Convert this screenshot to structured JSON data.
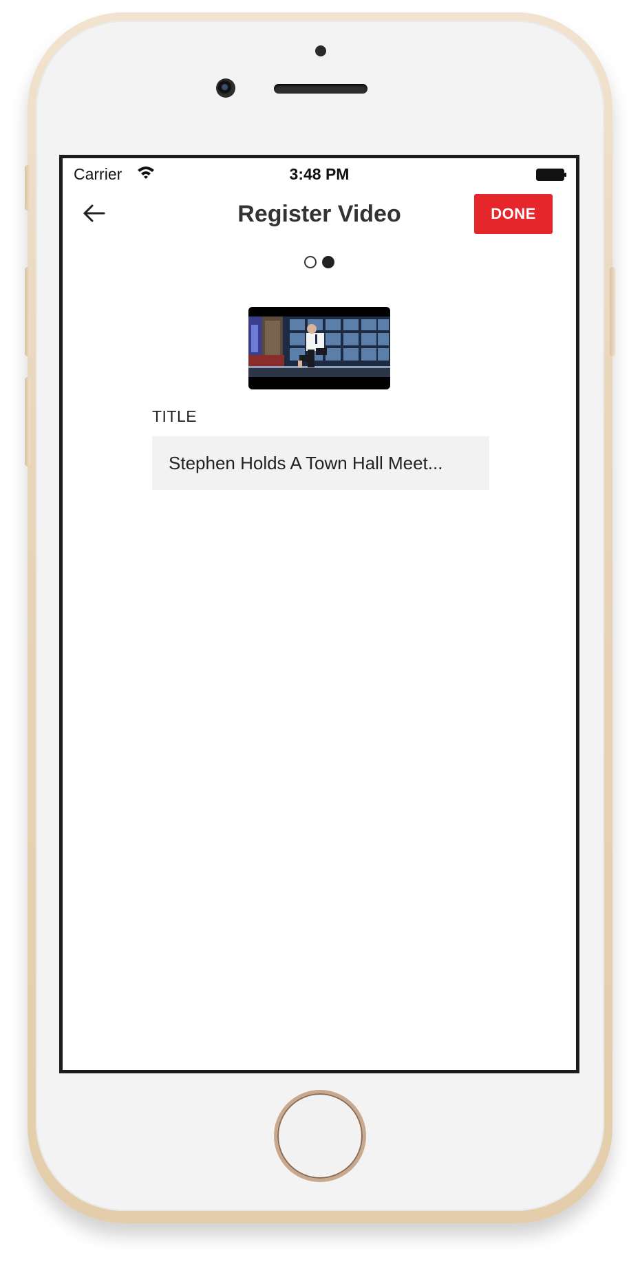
{
  "status_bar": {
    "carrier": "Carrier",
    "time": "3:48 PM",
    "wifi_icon": "wifi-icon",
    "battery_icon": "battery-icon"
  },
  "nav": {
    "back_icon": "arrow-left-icon",
    "title": "Register Video",
    "done_label": "DONE",
    "done_color": "#e5262a"
  },
  "page_indicator": {
    "total": 2,
    "current": 2
  },
  "video": {
    "thumbnail_icon": "video-thumbnail"
  },
  "form": {
    "title_label": "TITLE",
    "title_value": "Stephen Holds A Town Hall Meet..."
  }
}
